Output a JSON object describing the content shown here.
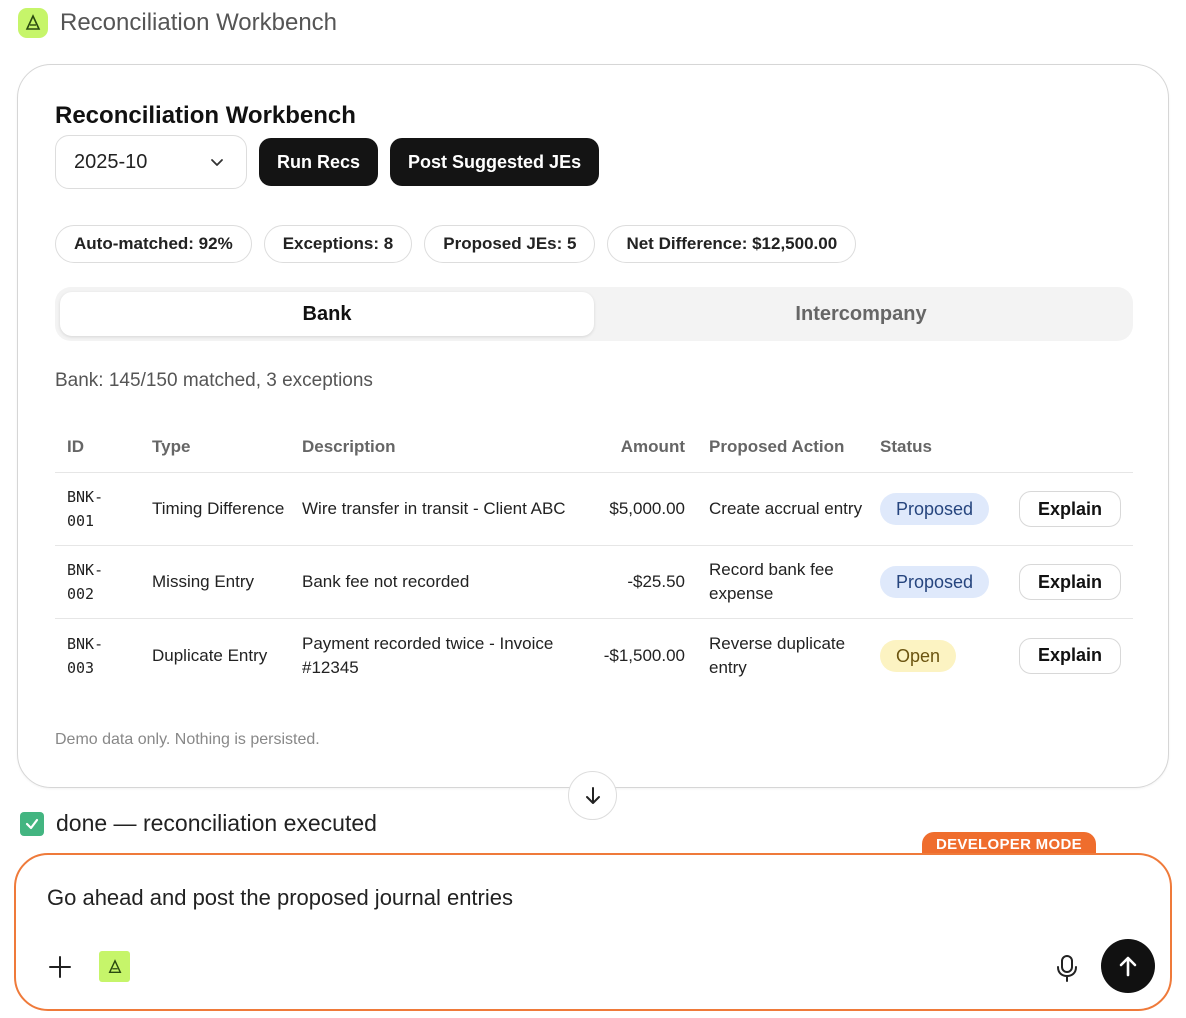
{
  "app": {
    "title": "Reconciliation Workbench",
    "logo_icon": "app-logo-icon"
  },
  "card": {
    "title": "Reconciliation Workbench",
    "period": {
      "value": "2025-10"
    },
    "buttons": {
      "run": "Run Recs",
      "post": "Post Suggested JEs"
    },
    "stats": [
      {
        "label": "Auto-matched: 92%"
      },
      {
        "label": "Exceptions: 8"
      },
      {
        "label": "Proposed JEs: 5"
      },
      {
        "label": "Net Difference: $12,500.00"
      }
    ],
    "tabs": [
      {
        "label": "Bank",
        "active": true
      },
      {
        "label": "Intercompany",
        "active": false
      }
    ],
    "summary": "Bank: 145/150 matched, 3 exceptions",
    "table": {
      "headers": {
        "id": "ID",
        "type": "Type",
        "description": "Description",
        "amount": "Amount",
        "action": "Proposed Action",
        "status": "Status"
      },
      "rows": [
        {
          "id_line1": "BNK-",
          "id_line2": "001",
          "type": "Timing Difference",
          "description": "Wire transfer in transit - Client ABC",
          "amount": "$5,000.00",
          "action": "Create accrual entry",
          "status": "Proposed",
          "button": "Explain"
        },
        {
          "id_line1": "BNK-",
          "id_line2": "002",
          "type": "Missing Entry",
          "description": "Bank fee not recorded",
          "amount": "-$25.50",
          "action": "Record bank fee expense",
          "status": "Proposed",
          "button": "Explain"
        },
        {
          "id_line1": "BNK-",
          "id_line2": "003",
          "type": "Duplicate Entry",
          "description": "Payment recorded twice - Invoice #12345",
          "amount": "-$1,500.00",
          "action": "Reverse duplicate entry",
          "status": "Open",
          "button": "Explain"
        }
      ]
    },
    "footnote": "Demo data only. Nothing is persisted."
  },
  "done_message": "done — reconciliation executed",
  "developer_mode": "DEVELOPER MODE",
  "composer": {
    "text": "Go ahead and post the proposed journal entries"
  },
  "colors": {
    "accent_orange": "#ef6d2d",
    "logo_green": "#c6f56a",
    "proposed_bg": "#dfe9fb",
    "open_bg": "#fcf3c2"
  }
}
